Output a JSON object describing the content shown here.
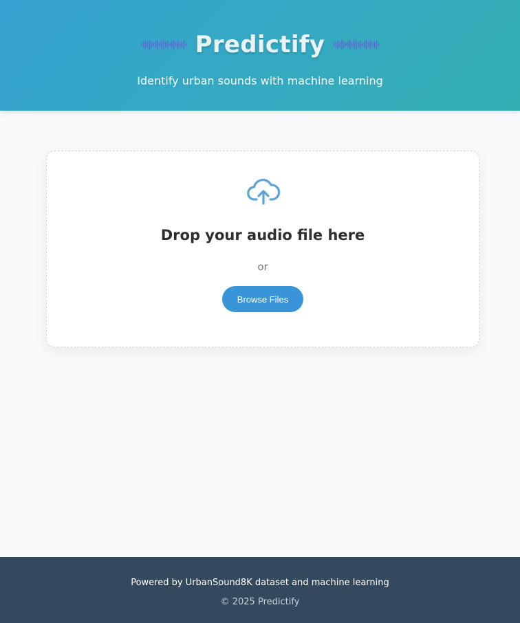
{
  "header": {
    "title": "Predictify",
    "tagline": "Identify urban sounds with machine learning",
    "left_icon": "sound-wave-icon",
    "right_icon": "sound-wave-icon"
  },
  "upload": {
    "icon": "cloud-upload-icon",
    "title": "Drop your audio file here",
    "or_text": "or",
    "browse_label": "Browse Files"
  },
  "footer": {
    "powered_by": "Powered by UrbanSound8K dataset and machine learning",
    "copyright": "© 2025 Predictify"
  },
  "colors": {
    "header_gradient_start": "#35a3d2",
    "header_gradient_end": "#33afb3",
    "accent": "#3a94d8",
    "footer_bg": "#34495e",
    "wave": "#6a5bd9"
  }
}
